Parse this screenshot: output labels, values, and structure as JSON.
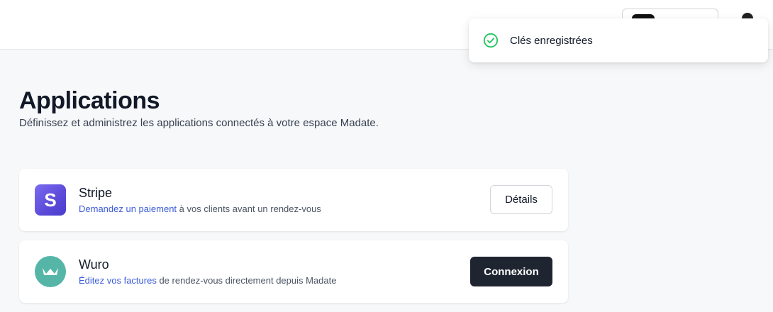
{
  "toast": {
    "message": "Clés enregistrées",
    "icon": "check-circle-icon",
    "color": "#22c55e"
  },
  "page": {
    "title": "Applications",
    "subtitle": "Définissez et administrez les applications connectés à votre espace Madate."
  },
  "apps": [
    {
      "name": "Stripe",
      "logo_letter": "S",
      "desc_link": "Demandez un paiement",
      "desc_rest": " à vos clients avant un rendez-vous",
      "button_label": "Détails"
    },
    {
      "name": "Wuro",
      "desc_link": "Éditez vos factures",
      "desc_rest": " de rendez-vous directement depuis Madate",
      "button_label": "Connexion"
    }
  ]
}
